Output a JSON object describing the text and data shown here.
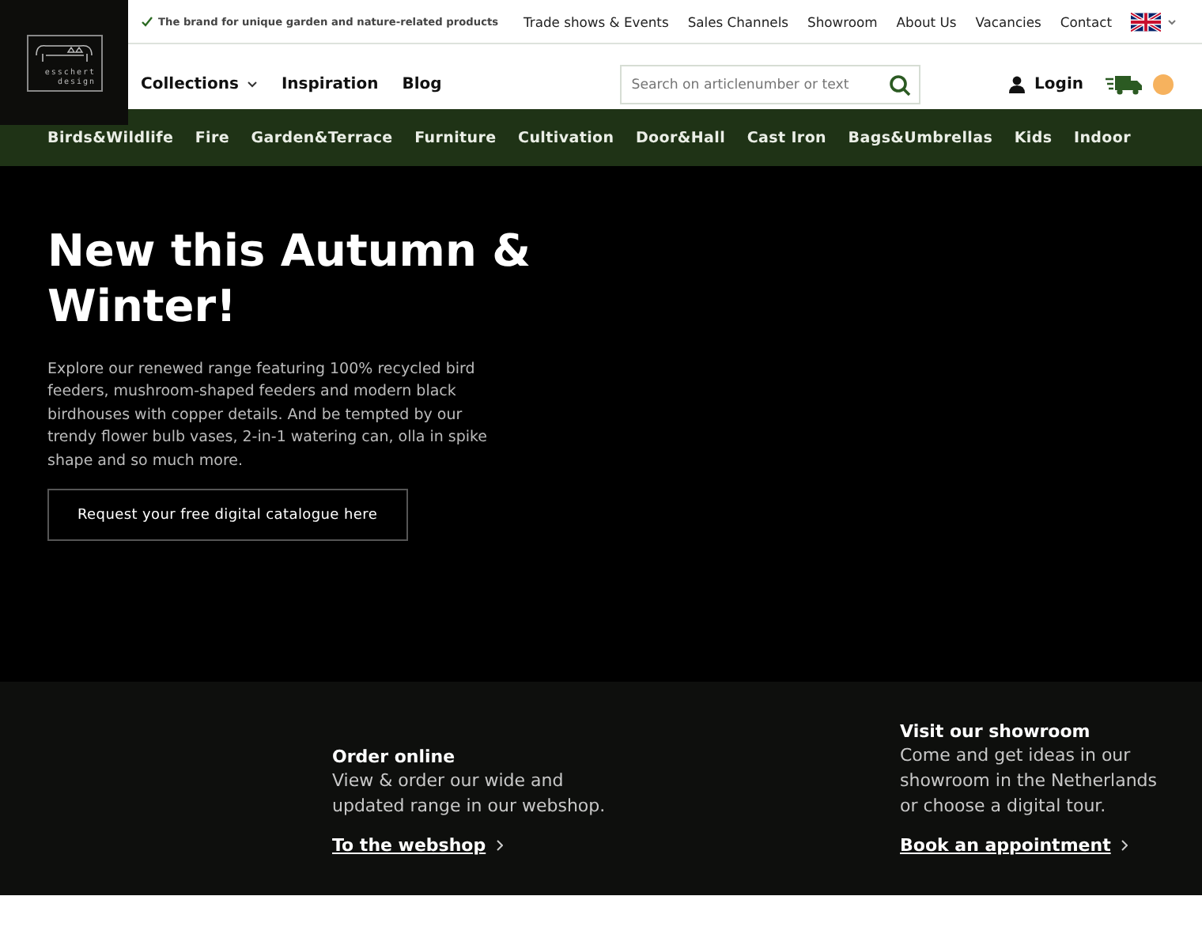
{
  "logo": {
    "line1": "esschert",
    "line2": "design"
  },
  "top_bar": {
    "tagline": "The brand for unique garden and nature-related products",
    "links": [
      "Trade shows & Events",
      "Sales Channels",
      "Showroom",
      "About Us",
      "Vacancies",
      "Contact"
    ]
  },
  "main_menu": [
    {
      "label": "Collections",
      "dropdown": true
    },
    {
      "label": "Inspiration",
      "dropdown": false
    },
    {
      "label": "Blog",
      "dropdown": false
    }
  ],
  "search": {
    "placeholder": "Search on articlenumber or text"
  },
  "login": "Login",
  "categories": [
    "Birds&Wildlife",
    "Fire",
    "Garden&Terrace",
    "Furniture",
    "Cultivation",
    "Door&Hall",
    "Cast Iron",
    "Bags&Umbrellas",
    "Kids",
    "Indoor"
  ],
  "hero": {
    "title": "New this Autumn & Winter!",
    "text": "Explore our renewed range featuring 100% recycled bird feeders, mushroom-shaped feeders and modern black birdhouses with copper details. And be tempted by our trendy flower bulb vases, 2-in-1 watering can, olla in spike shape and so much more.",
    "button": "Request your free digital catalogue here"
  },
  "info_blocks": [
    {
      "title": "Order online",
      "text": "View & order our wide and updated range in our webshop.",
      "link": "To the webshop"
    },
    {
      "title": "Visit our showroom",
      "text": "Come and get ideas in our showroom in the Netherlands or choose a digital tour.",
      "link": "Book an appointment"
    }
  ]
}
